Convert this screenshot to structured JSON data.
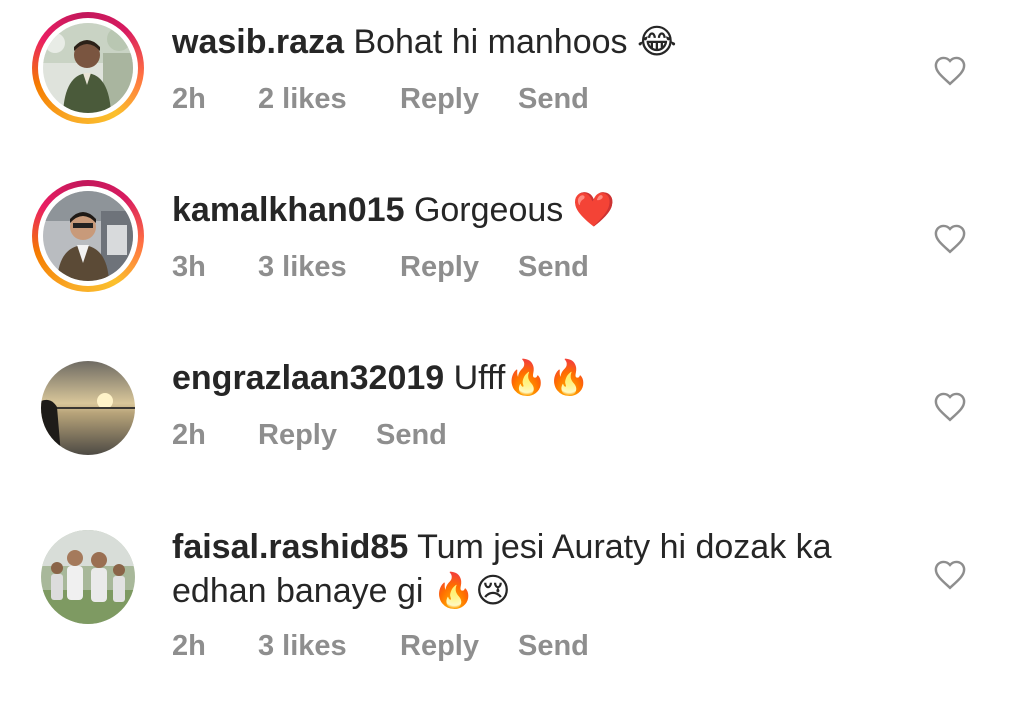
{
  "comments": [
    {
      "username": "wasib.raza",
      "text": "Bohat hi manhoos",
      "emoji": "😂",
      "time": "2h",
      "likes": "2 likes",
      "reply": "Reply",
      "send": "Send",
      "avatar_ring": true
    },
    {
      "username": "kamalkhan015",
      "text": "Gorgeous",
      "emoji": "❤️",
      "time": "3h",
      "likes": "3 likes",
      "reply": "Reply",
      "send": "Send",
      "avatar_ring": true
    },
    {
      "username": "engrazlaan32019",
      "text": "Ufff",
      "emoji": "🔥🔥",
      "time": "2h",
      "reply": "Reply",
      "send": "Send",
      "avatar_ring": false
    },
    {
      "username": "faisal.rashid85",
      "text": "Tum jesi Auraty hi dozak ka",
      "text_line2": "edhan banaye gi",
      "emoji": "🔥😢",
      "time": "2h",
      "likes": "3 likes",
      "reply": "Reply",
      "send": "Send",
      "avatar_ring": false
    }
  ],
  "icons": {
    "like": "heart-outline-icon"
  },
  "colors": {
    "text": "#262626",
    "meta": "#8e8e8e",
    "ring_start": "#f9a825",
    "ring_end": "#c2185b"
  }
}
